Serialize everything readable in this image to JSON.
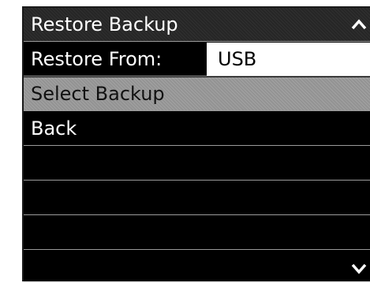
{
  "menu": {
    "title": "Restore Backup",
    "items": [
      {
        "label": "Restore From:",
        "value": "USB"
      },
      {
        "label": "Select Backup"
      },
      {
        "label": "Back"
      }
    ],
    "scroll_up_icon": "chevron-up-icon",
    "scroll_down_icon": "chevron-down-icon"
  },
  "colors": {
    "screen_background": "#000000",
    "text": "#ffffff",
    "highlight": "#9b9b9b",
    "value_box": "#ffffff",
    "row_divider": "#9a9a9a"
  }
}
